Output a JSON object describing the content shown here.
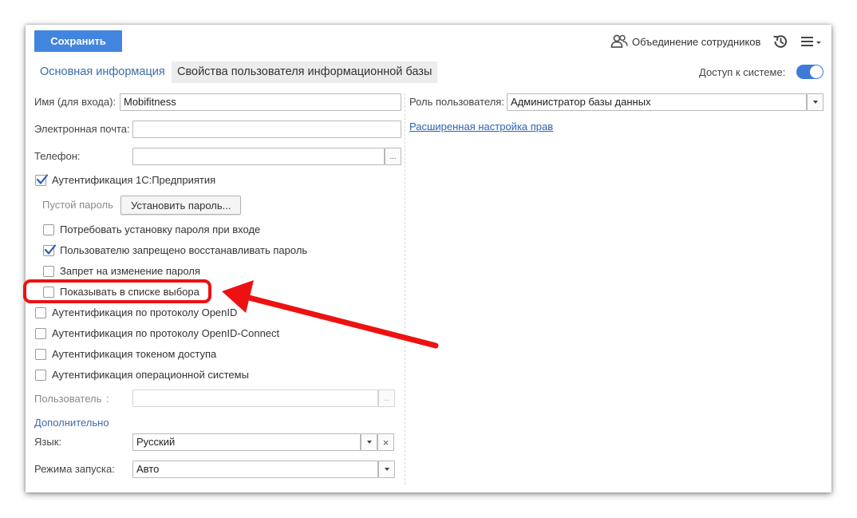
{
  "toolbar": {
    "save_label": "Сохранить",
    "merge_employees_label": "Объединение сотрудников"
  },
  "tabs": [
    {
      "label": "Основная информация",
      "active": true
    },
    {
      "label": "Свойства пользователя информационной базы",
      "active": false
    }
  ],
  "access": {
    "label": "Доступ к системе:",
    "enabled": true
  },
  "fields": {
    "login": {
      "label": "Имя (для входа):",
      "value": "Mobifitness"
    },
    "email": {
      "label": "Электронная почта:",
      "value": ""
    },
    "phone": {
      "label": "Телефон:",
      "value": "",
      "choose_label": "..."
    },
    "role": {
      "label": "Роль пользователя:",
      "value": "Администратор базы данных"
    },
    "os_user": {
      "label": "Пользователь",
      "colon": ":",
      "value": "",
      "choose_label": "..."
    },
    "language": {
      "label": "Язык:",
      "value": "Русский",
      "clear_label": "×"
    },
    "launch_mode": {
      "label": "Режима запуска:",
      "value": "Авто"
    }
  },
  "auth_1c": {
    "label": "Аутентификация 1С:Предприятия",
    "checked": true
  },
  "password": {
    "empty_label": "Пустой пароль",
    "set_button_label": "Установить пароль..."
  },
  "password_options": [
    {
      "label": "Потребовать установку пароля при входе",
      "checked": false
    },
    {
      "label": "Пользователю запрещено восстанавливать пароль",
      "checked": true
    },
    {
      "label": "Запрет на изменение пароля",
      "checked": false
    },
    {
      "label": "Показывать в списке выбора",
      "checked": false
    }
  ],
  "auth_options": [
    {
      "label": "Аутентификация по протоколу OpenID",
      "checked": false
    },
    {
      "label": "Аутентификация по протоколу OpenID-Connect",
      "checked": false
    },
    {
      "label": "Аутентификация токеном доступа",
      "checked": false
    },
    {
      "label": "Аутентификация операционной системы",
      "checked": false
    }
  ],
  "advanced_rights_link": "Расширенная настройка прав",
  "additional_section": "Дополнительно",
  "colors": {
    "accent": "#4185de",
    "link": "#2b63b0",
    "annotation": "#ee1111",
    "toggle": "#3f7ad6"
  }
}
